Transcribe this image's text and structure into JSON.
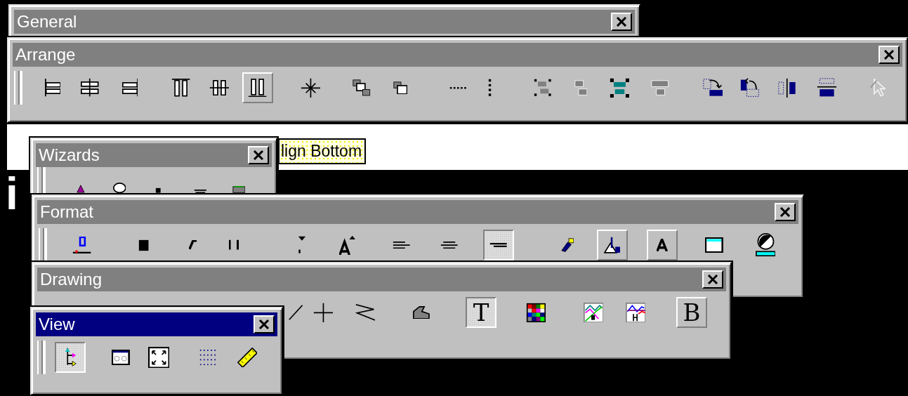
{
  "background_text": [
    {
      "text": "i"
    }
  ],
  "windows": [
    {
      "title": "General",
      "active": false
    },
    {
      "title": "Arrange",
      "active": false,
      "buttons": [
        {
          "raised": false,
          "pressed": false,
          "disabled": false
        },
        {
          "raised": false,
          "pressed": false,
          "disabled": false
        },
        {
          "raised": false,
          "pressed": false,
          "disabled": false
        },
        {
          "raised": false,
          "pressed": false,
          "disabled": false
        },
        {
          "raised": false,
          "pressed": false,
          "disabled": false
        },
        {
          "raised": true,
          "pressed": false,
          "disabled": false
        },
        {
          "raised": false,
          "pressed": false,
          "disabled": false
        },
        {
          "raised": false,
          "pressed": false,
          "disabled": false
        },
        {
          "raised": false,
          "pressed": false,
          "disabled": false
        },
        {
          "raised": false,
          "pressed": false,
          "disabled": false
        },
        {
          "raised": false,
          "pressed": false,
          "disabled": false
        },
        {
          "raised": false,
          "pressed": false,
          "disabled": false
        },
        {
          "raised": false,
          "pressed": false,
          "disabled": false
        },
        {
          "raised": false,
          "pressed": false,
          "disabled": false
        },
        {
          "raised": false,
          "pressed": false,
          "disabled": false
        },
        {
          "raised": false,
          "pressed": false,
          "disabled": false
        },
        {
          "raised": false,
          "pressed": false,
          "disabled": false
        },
        {
          "raised": false,
          "pressed": false,
          "disabled": false
        },
        {
          "raised": false,
          "pressed": false,
          "disabled": false
        },
        {
          "raised": false,
          "pressed": false,
          "disabled": true
        }
      ]
    },
    {
      "title": "Wizards",
      "active": false,
      "buttons": [
        {
          "raised": false,
          "pressed": false
        },
        {
          "raised": false,
          "pressed": false
        },
        {
          "raised": false,
          "pressed": false
        },
        {
          "raised": false,
          "pressed": false
        },
        {
          "raised": false,
          "pressed": false
        }
      ]
    },
    {
      "title": "Format",
      "active": false,
      "buttons": [
        {
          "raised": false,
          "pressed": false
        },
        {
          "raised": false,
          "pressed": false
        },
        {
          "raised": false,
          "pressed": false
        },
        {
          "raised": false,
          "pressed": false
        },
        {
          "raised": false,
          "pressed": false
        },
        {
          "raised": false,
          "pressed": false
        },
        {
          "raised": false,
          "pressed": false
        },
        {
          "raised": false,
          "pressed": false
        },
        {
          "raised": false,
          "pressed": true
        },
        {
          "raised": false,
          "pressed": false
        },
        {
          "raised": true,
          "pressed": false
        },
        {
          "raised": true,
          "pressed": false
        },
        {
          "raised": false,
          "pressed": false
        },
        {
          "raised": false,
          "pressed": false
        }
      ]
    },
    {
      "title": "Drawing",
      "active": false,
      "buttons": [
        {
          "raised": false,
          "pressed": false
        },
        {
          "raised": false,
          "pressed": false
        },
        {
          "raised": false,
          "pressed": false
        },
        {
          "raised": false,
          "pressed": false
        },
        {
          "raised": false,
          "pressed": true,
          "label": "T"
        },
        {
          "raised": false,
          "pressed": false
        },
        {
          "raised": false,
          "pressed": false
        },
        {
          "raised": false,
          "pressed": false
        },
        {
          "raised": true,
          "pressed": false,
          "label": "B"
        }
      ]
    },
    {
      "title": "View",
      "active": true,
      "buttons": [
        {
          "raised": false,
          "pressed": true
        },
        {
          "raised": false,
          "pressed": false
        },
        {
          "raised": false,
          "pressed": false
        },
        {
          "raised": false,
          "pressed": false
        },
        {
          "raised": false,
          "pressed": false
        }
      ]
    }
  ],
  "tooltip": {
    "text": "lign Bottom"
  }
}
